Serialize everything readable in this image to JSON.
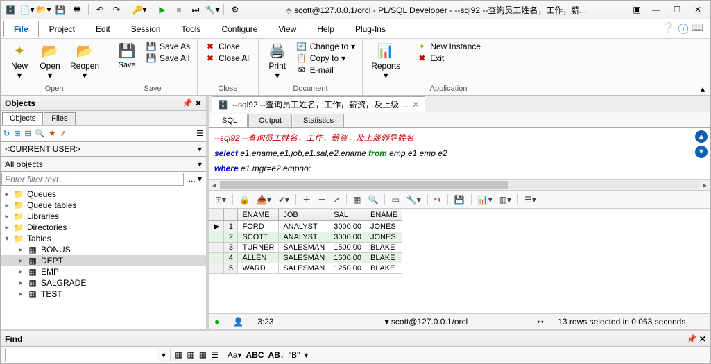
{
  "title": "scott@127.0.0.1/orcl - PL/SQL Developer - --sql92 --查询员工姓名，工作，薪...",
  "menu": {
    "items": [
      "File",
      "Project",
      "Edit",
      "Session",
      "Tools",
      "Configure",
      "View",
      "Help",
      "Plug-Ins"
    ],
    "active": "File"
  },
  "ribbon": {
    "open": {
      "label": "Open",
      "items": {
        "new": "New",
        "open": "Open",
        "reopen": "Reopen"
      }
    },
    "save": {
      "label": "Save",
      "items": {
        "save": "Save",
        "save_as": "Save As",
        "save_all": "Save All"
      }
    },
    "close": {
      "label": "Close",
      "items": {
        "close": "Close",
        "close_all": "Close All"
      }
    },
    "document": {
      "label": "Document",
      "items": {
        "print": "Print",
        "change_to": "Change to",
        "copy_to": "Copy to",
        "email": "E-mail"
      }
    },
    "reports_label": "Reports",
    "application": {
      "label": "Application",
      "items": {
        "new_instance": "New Instance",
        "exit": "Exit"
      }
    }
  },
  "objects": {
    "title": "Objects",
    "tabs": [
      "Objects",
      "Files"
    ],
    "current_user": "<CURRENT USER>",
    "all_objects": "All objects",
    "filter_placeholder": "Enter filter text...",
    "tree_top": [
      "Queues",
      "Queue tables",
      "Libraries",
      "Directories",
      "Tables"
    ],
    "tables": [
      "BONUS",
      "DEPT",
      "EMP",
      "SALGRADE",
      "TEST"
    ],
    "selected": "DEPT"
  },
  "editor": {
    "tab_label": "--sql92 --查询员工姓名，工作，薪资，及上级 ...",
    "subtabs": [
      "SQL",
      "Output",
      "Statistics"
    ],
    "active_subtab": "SQL",
    "sql": {
      "comment": "--sql92 --查询员工姓名，工作，薪资，及上级领导姓名",
      "kw_select": "select",
      "cols": " e1.ename,e1.job,e1.sal,e2.ename ",
      "kw_from": "from",
      "tables": " emp e1,emp e2",
      "kw_where": "where",
      "cond": " e1.mgr=e2.empno;"
    }
  },
  "results": {
    "columns": [
      "ENAME",
      "JOB",
      "SAL",
      "ENAME"
    ],
    "rows": [
      {
        "n": "1",
        "c": [
          "FORD",
          "ANALYST",
          "3000.00",
          "JONES"
        ],
        "ptr": "▶"
      },
      {
        "n": "2",
        "c": [
          "SCOTT",
          "ANALYST",
          "3000.00",
          "JONES"
        ],
        "sel": true
      },
      {
        "n": "3",
        "c": [
          "TURNER",
          "SALESMAN",
          "1500.00",
          "BLAKE"
        ]
      },
      {
        "n": "4",
        "c": [
          "ALLEN",
          "SALESMAN",
          "1600.00",
          "BLAKE"
        ],
        "sel": true
      },
      {
        "n": "5",
        "c": [
          "WARD",
          "SALESMAN",
          "1250.00",
          "BLAKE"
        ]
      }
    ]
  },
  "status": {
    "pos": "3:23",
    "conn": "scott@127.0.0.1/orcl",
    "msg": "13 rows selected in 0.063 seconds"
  },
  "find": {
    "title": "Find"
  }
}
